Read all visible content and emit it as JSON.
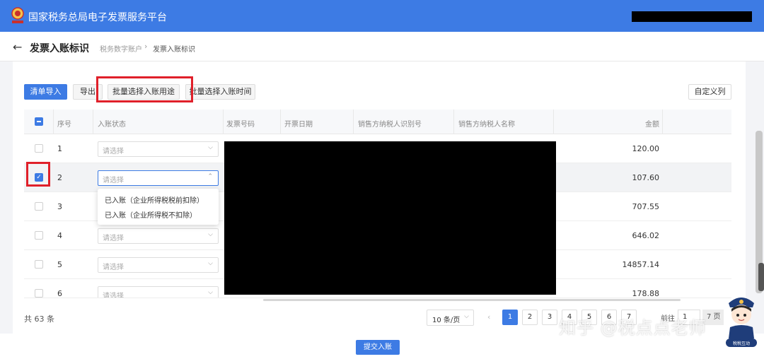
{
  "app": {
    "title": "国家税务总局电子发票服务平台"
  },
  "subheader": {
    "title": "发票入账标识",
    "breadcrumb": [
      "税务数字账户",
      "发票入账标识"
    ]
  },
  "toolbar": {
    "import_label": "清单导入",
    "export_label": "导出",
    "batch_purpose_label": "批量选择入账用途",
    "batch_time_label": "批量选择入账时间",
    "custom_columns_label": "自定义列"
  },
  "table": {
    "columns": [
      "序号",
      "入账状态",
      "发票号码",
      "开票日期",
      "销售方纳税人识别号",
      "销售方纳税人名称",
      "金额"
    ],
    "select_placeholder": "请选择",
    "rows": [
      {
        "seq": "1",
        "amount": "120.00",
        "checked": false
      },
      {
        "seq": "2",
        "amount": "107.60",
        "checked": true
      },
      {
        "seq": "3",
        "amount": "707.55",
        "checked": false
      },
      {
        "seq": "4",
        "amount": "646.02",
        "checked": false
      },
      {
        "seq": "5",
        "amount": "14857.14",
        "checked": false
      },
      {
        "seq": "6",
        "amount": "178.88",
        "checked": false
      }
    ],
    "dropdown_options": [
      "已入账（企业所得税税前扣除）",
      "已入账（企业所得税不扣除）"
    ]
  },
  "pagination": {
    "total": "共 63 条",
    "page_size": "10 条/页",
    "pages": [
      "1",
      "2",
      "3",
      "4",
      "5",
      "6",
      "7"
    ],
    "current": "1",
    "goto_label": "前往",
    "goto_value": "1",
    "goto_suffix": "7 页"
  },
  "footer": {
    "submit_label": "提交入账"
  },
  "watermark": "知乎 @税点点老师",
  "mascot_badge": "税税互动",
  "colors": {
    "primary": "#3d7be4",
    "highlight": "#e0202a"
  }
}
